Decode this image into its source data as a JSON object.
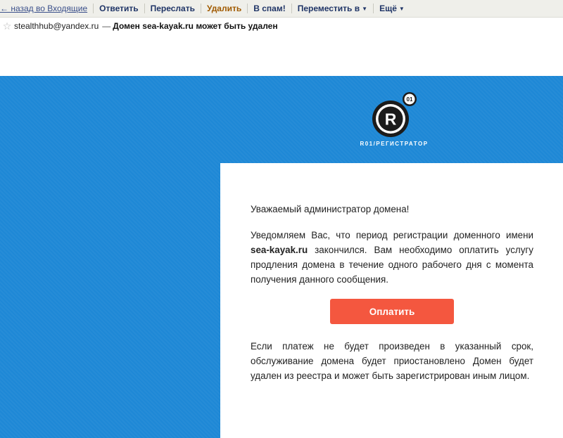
{
  "toolbar": {
    "back_label": "← назад во Входящие",
    "reply_label": "Ответить",
    "forward_label": "Переслать",
    "delete_label": "Удалить",
    "spam_label": "В спам!",
    "move_label": "Переместить в",
    "more_label": "Ещё"
  },
  "message": {
    "sender": "stealthhub@yandex.ru",
    "dash": "—",
    "subject": "Домен sea-kayak.ru может быть удален"
  },
  "email": {
    "logo_letter": "R",
    "logo_badge": "01",
    "logo_caption": "R01/РЕГИСТРАТОР",
    "greeting": "Уважаемый администратор домена!",
    "notice_before": "Уведомляем Вас, что период регистрации доменного имени ",
    "domain": "sea-kayak.ru",
    "notice_after": " закончился. Вам необходимо оплатить услугу продления домена в течение одного рабочего дня с момента получения данного сообщения.",
    "pay_button": "Оплатить",
    "warning": "Если платеж не будет произведен в указанный срок, обслуживание домена будет приостановлено Домен будет удален из реестра и может быть зарегистрирован иным лицом."
  },
  "colors": {
    "banner_blue": "#1e88d6",
    "pay_button": "#f4573f",
    "toolbar_bg": "#efefea"
  },
  "icons": {
    "star": "star-icon",
    "caret": "chevron-down-icon",
    "logo": "r01-registrar-logo"
  }
}
